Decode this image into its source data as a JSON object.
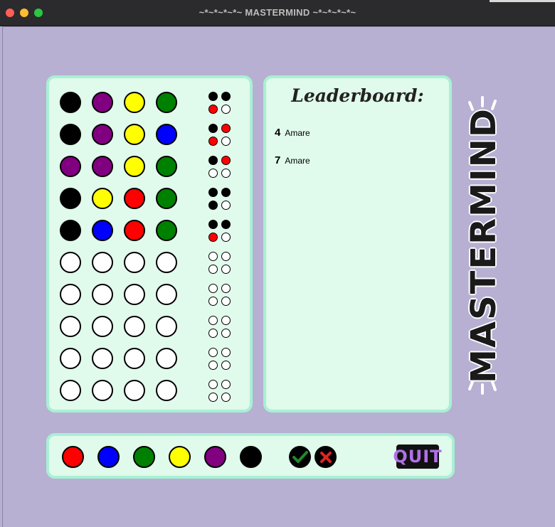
{
  "window": {
    "title": "~*~*~*~*~ MASTERMIND ~*~*~*~*~"
  },
  "colors": {
    "black": "#000000",
    "purple": "#800080",
    "yellow": "#ffff00",
    "green": "#008000",
    "blue": "#0000ff",
    "red": "#ff0000",
    "white": "#ffffff",
    "background": "#b7b0d2",
    "panel": "#e0faeb",
    "panel_border": "#a8f0d4"
  },
  "board": {
    "rows": [
      {
        "guess": [
          "black",
          "purple",
          "yellow",
          "green"
        ],
        "feedback": [
          "black",
          "black",
          "red",
          "white"
        ]
      },
      {
        "guess": [
          "black",
          "purple",
          "yellow",
          "blue"
        ],
        "feedback": [
          "black",
          "red",
          "red",
          "white"
        ]
      },
      {
        "guess": [
          "purple",
          "purple",
          "yellow",
          "green"
        ],
        "feedback": [
          "black",
          "red",
          "white",
          "white"
        ]
      },
      {
        "guess": [
          "black",
          "yellow",
          "red",
          "green"
        ],
        "feedback": [
          "black",
          "black",
          "black",
          "white"
        ]
      },
      {
        "guess": [
          "black",
          "blue",
          "red",
          "green"
        ],
        "feedback": [
          "black",
          "black",
          "red",
          "white"
        ]
      },
      {
        "guess": [
          "white",
          "white",
          "white",
          "white"
        ],
        "feedback": [
          "white",
          "white",
          "white",
          "white"
        ]
      },
      {
        "guess": [
          "white",
          "white",
          "white",
          "white"
        ],
        "feedback": [
          "white",
          "white",
          "white",
          "white"
        ]
      },
      {
        "guess": [
          "white",
          "white",
          "white",
          "white"
        ],
        "feedback": [
          "white",
          "white",
          "white",
          "white"
        ]
      },
      {
        "guess": [
          "white",
          "white",
          "white",
          "white"
        ],
        "feedback": [
          "white",
          "white",
          "white",
          "white"
        ]
      },
      {
        "guess": [
          "white",
          "white",
          "white",
          "white"
        ],
        "feedback": [
          "white",
          "white",
          "white",
          "white"
        ]
      }
    ]
  },
  "leaderboard": {
    "title": "Leaderboard:",
    "entries": [
      {
        "score": "4",
        "name": "Amare"
      },
      {
        "score": "7",
        "name": "Amare"
      }
    ]
  },
  "palette": [
    "red",
    "blue",
    "green",
    "yellow",
    "purple",
    "black"
  ],
  "controls": {
    "confirm_icon": "check-icon",
    "clear_icon": "x-icon",
    "quit_label": "QUIT"
  },
  "side_logo": "MASTERMIND"
}
